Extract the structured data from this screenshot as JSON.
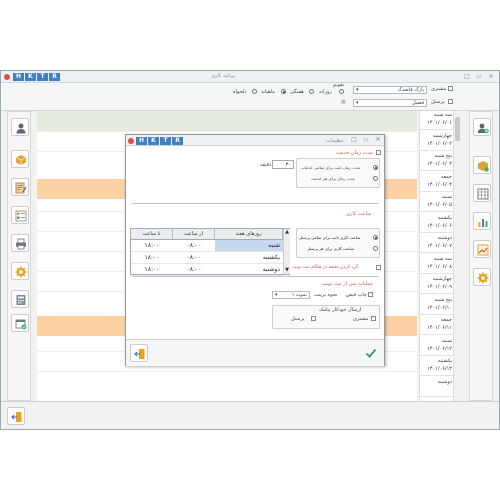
{
  "window": {
    "title": "برنامه کاری",
    "logo_letters": [
      "H",
      "K",
      "T",
      "R"
    ],
    "controls": [
      "□",
      "▭",
      "✕"
    ]
  },
  "toolbar": {
    "row1": {
      "customer_label": "مشتری",
      "customer_value": "پارک قاصدک",
      "period_label": "تقویم",
      "period_options": [
        "روزانه",
        "هفتگی",
        "ماهیانه",
        "دلخواه"
      ],
      "period_selected": "ماهیانه"
    },
    "row2": {
      "personnel_label": "پرسنل",
      "personnel_value": "فضیل"
    }
  },
  "days": [
    {
      "name": "سه شنبه",
      "date": "۱۴۰۱/۰۶/۰۱"
    },
    {
      "name": "چهارشنبه",
      "date": "۱۴۰۱/۰۶/۰۲"
    },
    {
      "name": "پنج شنبه",
      "date": "۱۴۰۱/۰۶/۰۳"
    },
    {
      "name": "جمعه",
      "date": "۱۴۰۱/۰۶/۰۴"
    },
    {
      "name": "شنبه",
      "date": "۱۴۰۱/۰۶/۰۵"
    },
    {
      "name": "یکشنبه",
      "date": "۱۴۰۱/۰۶/۰۶"
    },
    {
      "name": "دوشنبه",
      "date": "۱۴۰۱/۰۶/۰۷"
    },
    {
      "name": "سه شنبه",
      "date": "۱۴۰۱/۰۶/۰۸"
    },
    {
      "name": "چهارشنبه",
      "date": "۱۴۰۱/۰۶/۰۹"
    },
    {
      "name": "پنج شنبه",
      "date": "۱۴۰۱/۰۶/۱۰"
    },
    {
      "name": "جمعه",
      "date": "۱۴۰۱/۰۶/۱۱"
    },
    {
      "name": "شنبه",
      "date": "۱۴۰۱/۰۶/۱۲"
    },
    {
      "name": "یکشنبه",
      "date": "۱۴۰۱/۰۶/۱۳"
    },
    {
      "name": "دوشنبه",
      "date": ""
    }
  ],
  "dialog": {
    "title": "تنظیمات",
    "logo_letters": [
      "H",
      "K",
      "T",
      "R"
    ],
    "service_duration": {
      "title": "مدت زمان خدمت",
      "value": "۳۰",
      "unit": "دقیقه",
      "options": [
        "مدت زمان ثابت برای تمامی خدمات",
        "مدت زمان برای هر خدمت"
      ],
      "selected": 0
    },
    "work_hours": {
      "title": "ساعت کاری",
      "columns": [
        "روزهای هفته",
        "از ساعت",
        "تا ساعت"
      ],
      "rows": [
        {
          "day": "شنبه",
          "from": "۰۸:۰۰",
          "to": "۱۸:۰۰"
        },
        {
          "day": "یکشنبه",
          "from": "۰۸:۰۰",
          "to": "۱۸:۰۰"
        },
        {
          "day": "دوشنبه",
          "from": "۰۸:۰۰",
          "to": "۱۸:۰۰"
        }
      ],
      "options": [
        "ساعت کاری ثابت برای تمامی پرسنل",
        "ساعت کاری برای هر پرسنل"
      ],
      "selected": 0,
      "round_label": "گرد کردن دقیقه در هنگام ثبت نوبت"
    },
    "after_booking": {
      "title": "عملیات پس از ثبت نوبت",
      "print_label": "چاپ قبض",
      "print_method_label": "نحوه پرینت",
      "print_method_value": "نمونه ۱",
      "sms_label": "ارسال خودکار پیامک",
      "sms_customer": "مشتری",
      "sms_personnel": "پرسنل"
    }
  }
}
